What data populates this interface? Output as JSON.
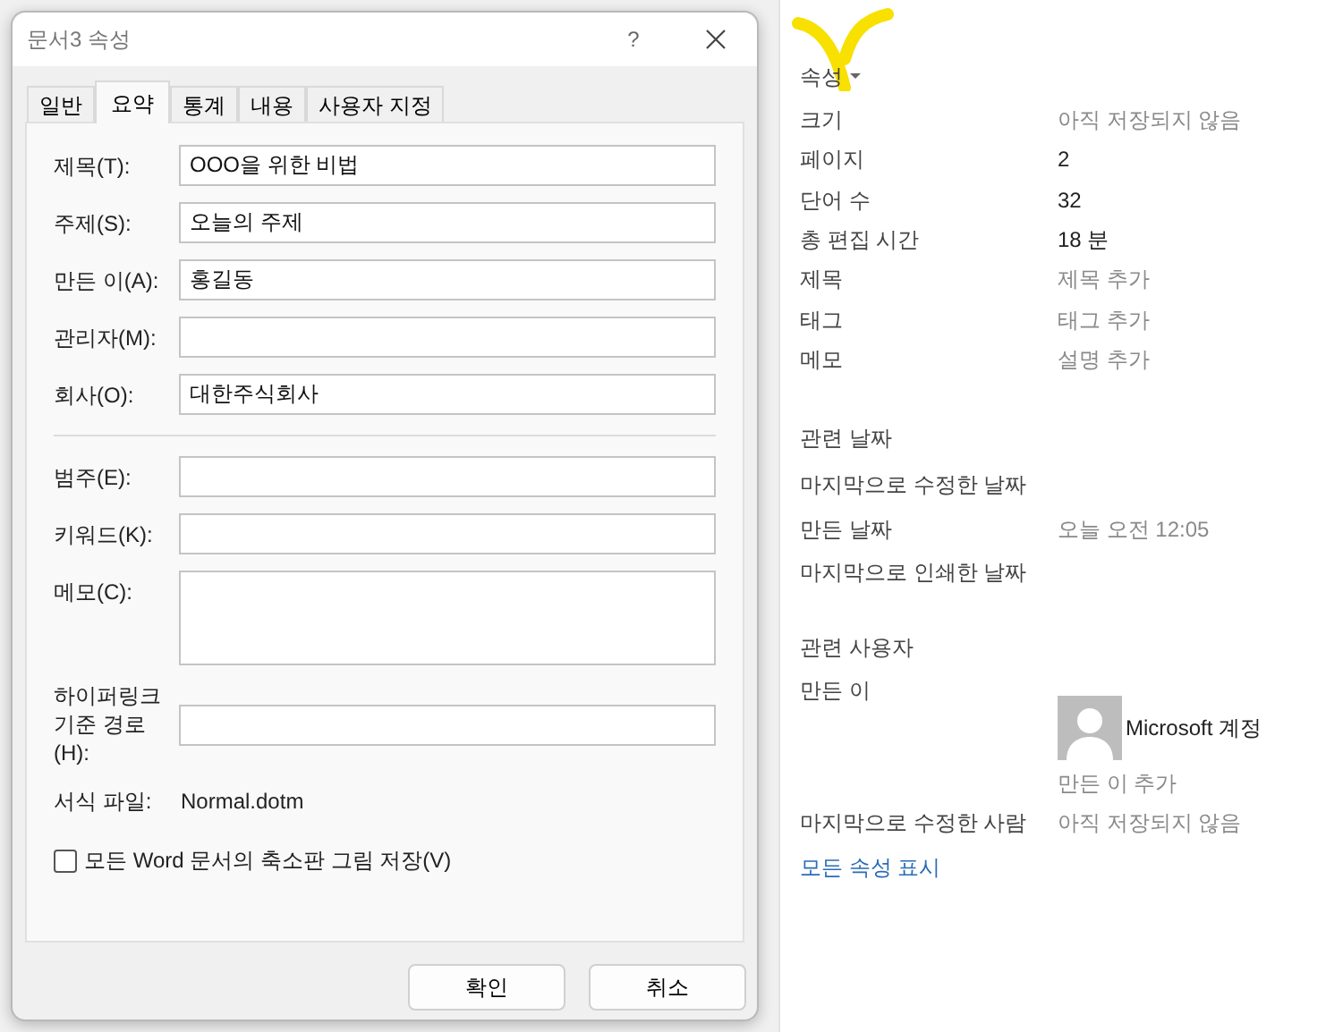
{
  "dialog": {
    "title": "문서3 속성",
    "help": "?",
    "tabs": [
      {
        "label": "일반",
        "selected": false
      },
      {
        "label": "요약",
        "selected": true
      },
      {
        "label": "통계",
        "selected": false
      },
      {
        "label": "내용",
        "selected": false
      },
      {
        "label": "사용자 지정",
        "selected": false
      }
    ],
    "fields_top": [
      {
        "label": "제목(T):",
        "value": "OOO을 위한 비법"
      },
      {
        "label": "주제(S):",
        "value": "오늘의 주제"
      },
      {
        "label": "만든 이(A):",
        "value": "홍길동"
      },
      {
        "label": "관리자(M):"
      },
      {
        "label": "회사(O):",
        "value": "대한주식회사"
      }
    ],
    "fields_bottom": [
      {
        "label": "범주(E):",
        "kind": "line"
      },
      {
        "label": "키워드(K):",
        "kind": "line"
      },
      {
        "label": "메모(C):",
        "kind": "area"
      },
      {
        "label": "하이퍼링크 기준 경로(H):",
        "kind": "line"
      }
    ],
    "template": {
      "label": "서식 파일:",
      "value": "Normal.dotm"
    },
    "thumbnail": {
      "label": "모든 Word 문서의 축소판 그림 저장(V)",
      "checked": false
    },
    "buttons": [
      "확인",
      "취소"
    ]
  },
  "info": {
    "properties": {
      "heading": "속성",
      "rows": [
        {
          "label": "크기",
          "value": "아직 저장되지 않음",
          "muted": true
        },
        {
          "label": "페이지",
          "value": "2",
          "muted": false
        },
        {
          "label": "단어 수",
          "value": "32",
          "muted": false
        },
        {
          "label": "총 편집 시간",
          "value": "18 분",
          "muted": false
        },
        {
          "label": "제목",
          "value": "제목 추가",
          "muted": true
        },
        {
          "label": "태그",
          "value": "태그 추가",
          "muted": true
        },
        {
          "label": "메모",
          "value": "설명 추가",
          "muted": true
        }
      ]
    },
    "dates": {
      "heading": "관련 날짜",
      "rows": [
        {
          "label": "마지막으로 수정한 날짜"
        },
        {
          "label": "만든 날짜",
          "value": "오늘 오전 12:05"
        },
        {
          "label": "마지막으로 인쇄한 날짜"
        }
      ]
    },
    "people": {
      "heading": "관련 사용자",
      "author_label": "만든 이",
      "author_name": "Microsoft 계정",
      "add_author": "만든 이 추가",
      "modified_label": "마지막으로 수정한 사람",
      "modified_value": "아직 저장되지 않음"
    },
    "show_all": "모든 속성 표시"
  }
}
